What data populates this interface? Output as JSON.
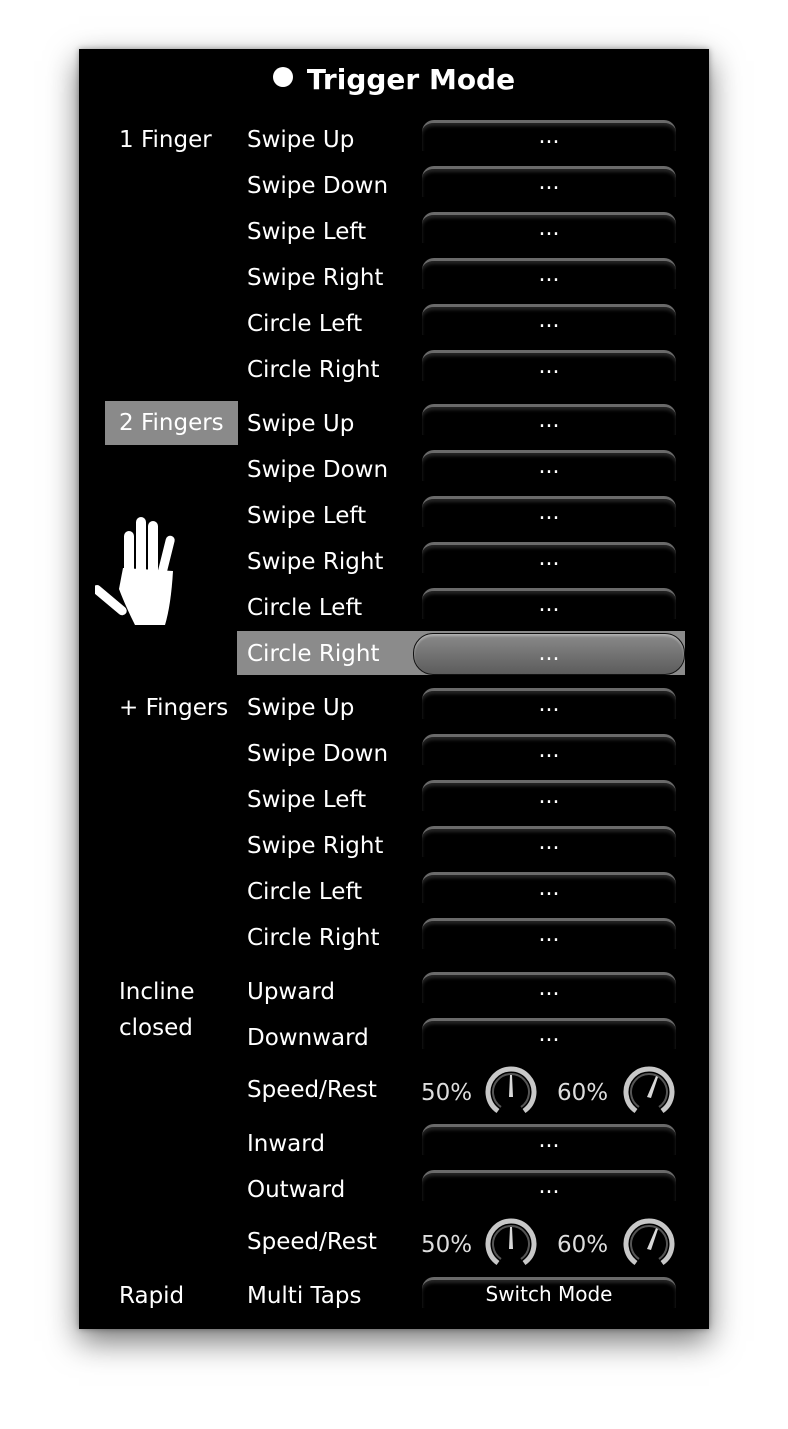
{
  "title": "Trigger Mode",
  "groups": [
    {
      "label": "1 Finger",
      "items": [
        "Swipe Up",
        "Swipe Down",
        "Swipe Left",
        "Swipe Right",
        "Circle Left",
        "Circle Right"
      ]
    },
    {
      "label": "2 Fingers",
      "items": [
        "Swipe Up",
        "Swipe Down",
        "Swipe Left",
        "Swipe Right",
        "Circle Left",
        "Circle Right"
      ]
    },
    {
      "label": "+ Fingers",
      "items": [
        "Swipe Up",
        "Swipe Down",
        "Swipe Left",
        "Swipe Right",
        "Circle Left",
        "Circle Right"
      ]
    }
  ],
  "button_placeholder": "...",
  "incline": {
    "label_line1": "Incline",
    "label_line2": "closed",
    "upward": "Upward",
    "downward": "Downward",
    "speed_rest_1": {
      "label": "Speed/Rest",
      "speed": "50%",
      "rest": "60%"
    },
    "inward": "Inward",
    "outward": "Outward",
    "speed_rest_2": {
      "label": "Speed/Rest",
      "speed": "50%",
      "rest": "60%"
    }
  },
  "rapid": {
    "label": "Rapid",
    "item": "Multi Taps",
    "button": "Switch Mode"
  },
  "colors": {
    "background": "#000000",
    "text": "#ffffff",
    "selection": "#8a8a8a"
  },
  "icons": {
    "hand": "hand-icon",
    "knob": "dial-knob-icon"
  }
}
